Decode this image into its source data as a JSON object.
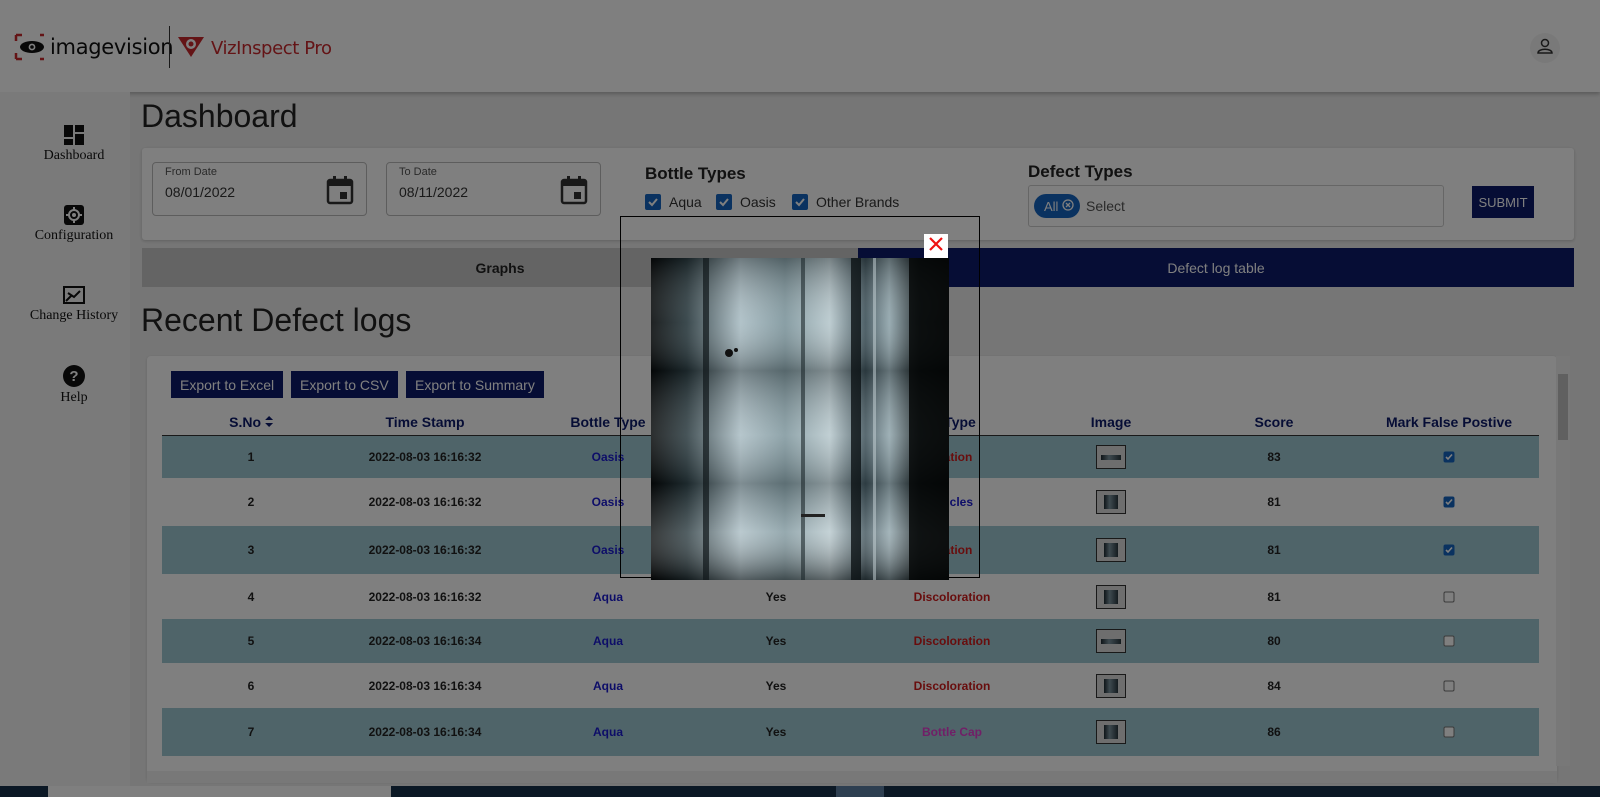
{
  "header": {
    "brand_name": "imagevision",
    "product_name": "VizInspect Pro",
    "user_icon": "user-icon"
  },
  "sidebar": {
    "items": [
      {
        "label": "Dashboard",
        "icon": "dashboard-icon"
      },
      {
        "label": "Configuration",
        "icon": "gear-icon"
      },
      {
        "label": "Change History",
        "icon": "history-icon"
      },
      {
        "label": "Help",
        "icon": "help-icon"
      }
    ]
  },
  "page": {
    "title": "Dashboard"
  },
  "filters": {
    "from_date": {
      "label": "From Date",
      "value": "08/01/2022"
    },
    "to_date": {
      "label": "To Date",
      "value": "08/11/2022"
    },
    "bottle_types": {
      "label": "Bottle Types",
      "options": [
        {
          "label": "Aqua",
          "checked": true
        },
        {
          "label": "Oasis",
          "checked": true
        },
        {
          "label": "Other Brands",
          "checked": true
        }
      ]
    },
    "defect_types": {
      "label": "Defect Types",
      "chip": "All",
      "placeholder": "Select"
    },
    "submit_label": "SUBMIT"
  },
  "tabs": [
    {
      "label": "Graphs",
      "active": false
    },
    {
      "label": "Defect log table",
      "active": true
    }
  ],
  "section_title": "Recent Defect logs",
  "export_buttons": [
    "Export to Excel",
    "Export to CSV",
    "Export to Summary"
  ],
  "table": {
    "columns": [
      "S.No",
      "Time Stamp",
      "Bottle Type",
      "",
      "Defect Type",
      "Image",
      "Score",
      "Mark False Postive"
    ],
    "visible_headers": {
      "sno": "S.No",
      "time": "Time Stamp",
      "bottle": "Bottle Type",
      "defect_partial": "Type",
      "image": "Image",
      "score": "Score",
      "mark": "Mark False Postive"
    },
    "rows": [
      {
        "sno": "1",
        "time": "2022-08-03 16:16:32",
        "bottle": "Oasis",
        "flag": "",
        "defect": "oration",
        "defect_color": "red",
        "score": "83",
        "marked": true,
        "thumb": "flat"
      },
      {
        "sno": "2",
        "time": "2022-08-03 16:16:32",
        "bottle": "Oasis",
        "flag": "",
        "defect": "articles",
        "defect_color": "navy",
        "score": "81",
        "marked": true,
        "thumb": "square"
      },
      {
        "sno": "3",
        "time": "2022-08-03 16:16:32",
        "bottle": "Oasis",
        "flag": "",
        "defect": "oration",
        "defect_color": "red",
        "score": "81",
        "marked": true,
        "thumb": "square"
      },
      {
        "sno": "4",
        "time": "2022-08-03 16:16:32",
        "bottle": "Aqua",
        "flag": "Yes",
        "defect": "Discoloration",
        "defect_color": "red",
        "score": "81",
        "marked": false,
        "thumb": "square"
      },
      {
        "sno": "5",
        "time": "2022-08-03 16:16:34",
        "bottle": "Aqua",
        "flag": "Yes",
        "defect": "Discoloration",
        "defect_color": "red",
        "score": "80",
        "marked": false,
        "thumb": "flat"
      },
      {
        "sno": "6",
        "time": "2022-08-03 16:16:34",
        "bottle": "Aqua",
        "flag": "Yes",
        "defect": "Discoloration",
        "defect_color": "red",
        "score": "84",
        "marked": false,
        "thumb": "square"
      },
      {
        "sno": "7",
        "time": "2022-08-03 16:16:34",
        "bottle": "Aqua",
        "flag": "Yes",
        "defect": "Bottle Cap",
        "defect_color": "pink",
        "score": "86",
        "marked": false,
        "thumb": "square"
      }
    ]
  },
  "modal": {
    "close_icon": "close-icon",
    "image_subject": "bottle-defect-closeup"
  },
  "colors": {
    "navy": "#0d1b6b",
    "brand_red": "#c8282d",
    "row_alt": "#9ec8d2",
    "checkbox_blue": "#1565c0"
  }
}
